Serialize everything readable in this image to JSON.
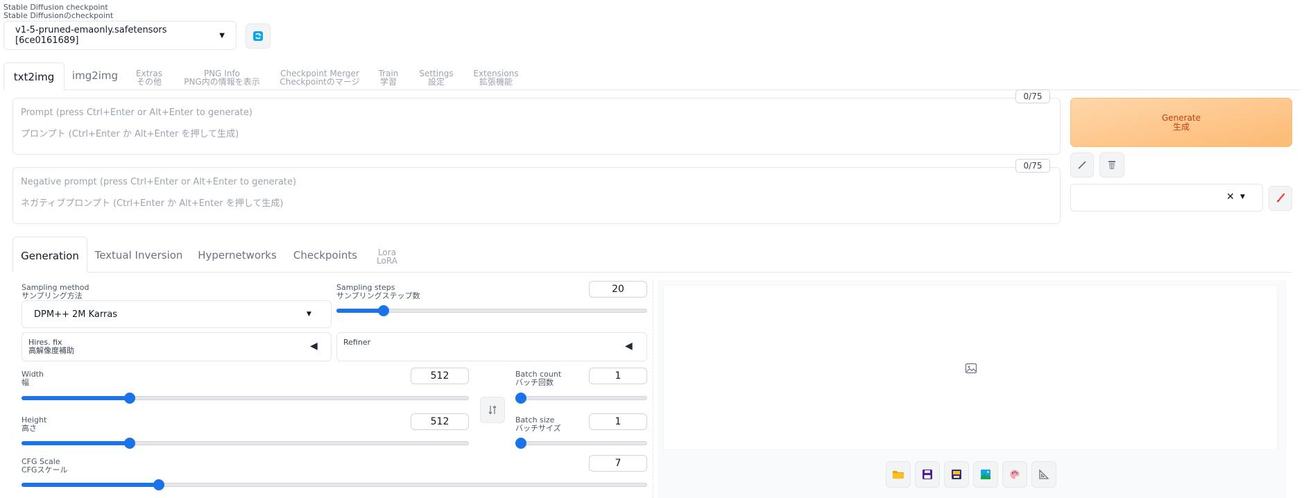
{
  "checkpoint": {
    "label_en": "Stable Diffusion checkpoint",
    "label_ja": "Stable Diffusionのcheckpoint",
    "value": "v1-5-pruned-emaonly.safetensors [6ce0161689]"
  },
  "top_tabs": [
    {
      "l1": "txt2img",
      "l2": ""
    },
    {
      "l1": "img2img",
      "l2": ""
    },
    {
      "l1": "Extras",
      "l2": "その他"
    },
    {
      "l1": "PNG Info",
      "l2": "PNG内の情報を表示"
    },
    {
      "l1": "Checkpoint Merger",
      "l2": "Checkpointのマージ"
    },
    {
      "l1": "Train",
      "l2": "学習"
    },
    {
      "l1": "Settings",
      "l2": "設定"
    },
    {
      "l1": "Extensions",
      "l2": "拡張機能"
    }
  ],
  "prompt": {
    "label": "Prompt (press Ctrl+Enter or Alt+Enter to generate)",
    "placeholder": "プロンプト (Ctrl+Enter か Alt+Enter を押して生成)",
    "counter": "0/75"
  },
  "negative_prompt": {
    "label": "Negative prompt (press Ctrl+Enter or Alt+Enter to generate)",
    "placeholder": "ネガティブプロンプト (Ctrl+Enter か Alt+Enter を押して生成)",
    "counter": "0/75"
  },
  "generate": {
    "l1": "Generate",
    "l2": "生成"
  },
  "sub_tabs": [
    {
      "l1": "Generation",
      "l2": ""
    },
    {
      "l1": "Textual Inversion",
      "l2": ""
    },
    {
      "l1": "Hypernetworks",
      "l2": ""
    },
    {
      "l1": "Checkpoints",
      "l2": ""
    },
    {
      "l1": "Lora",
      "l2": "LoRA"
    }
  ],
  "sampling_method": {
    "label_en": "Sampling method",
    "label_ja": "サンプリング方法",
    "value": "DPM++ 2M Karras"
  },
  "sampling_steps": {
    "label_en": "Sampling steps",
    "label_ja": "サンプリングステップ数",
    "value": "20",
    "fraction": 0.14
  },
  "hires": {
    "l1": "Hires. fix",
    "l2": "高解像度補助"
  },
  "refiner": {
    "label": "Refiner"
  },
  "width": {
    "label_en": "Width",
    "label_ja": "幅",
    "value": "512",
    "fraction": 0.235
  },
  "height": {
    "label_en": "Height",
    "label_ja": "高さ",
    "value": "512",
    "fraction": 0.235
  },
  "batch_count": {
    "label_en": "Batch count",
    "label_ja": "バッチ回数",
    "value": "1",
    "fraction": 0.0
  },
  "batch_size": {
    "label_en": "Batch size",
    "label_ja": "バッチサイズ",
    "value": "1",
    "fraction": 0.0
  },
  "cfg": {
    "label_en": "CFG Scale",
    "label_ja": "CFGスケール",
    "value": "7",
    "fraction": 0.215
  },
  "colors": {
    "accent": "#1a73e8",
    "generate_from": "#fed7aa",
    "generate_to": "#fdba74",
    "generate_text": "#c2410c"
  }
}
